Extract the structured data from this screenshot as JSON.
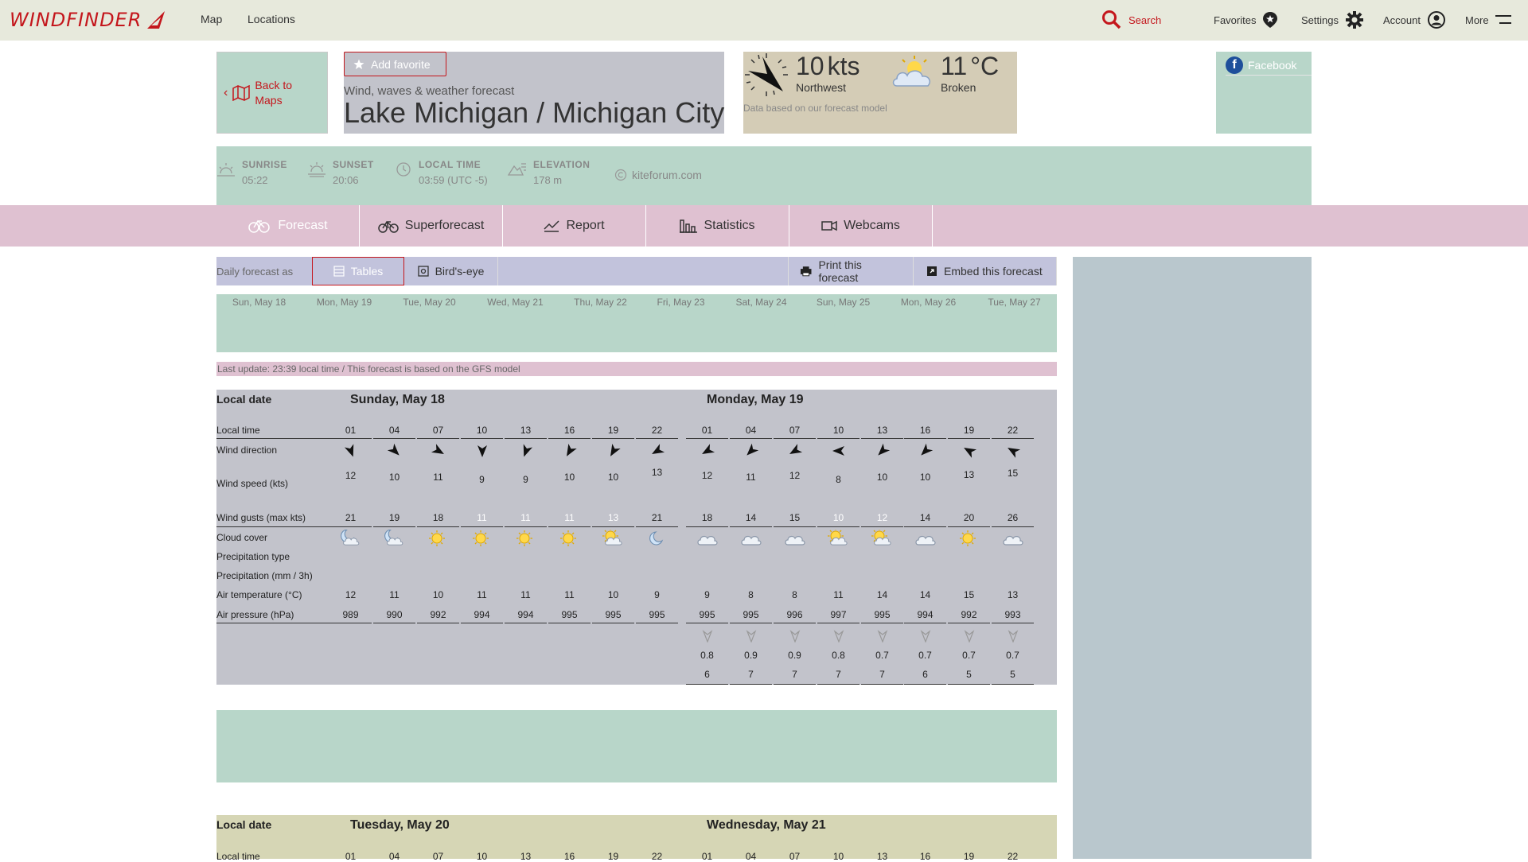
{
  "nav": {
    "logo": "WINDFINDER",
    "links": [
      "Map",
      "Locations"
    ],
    "search": "Search",
    "favorites": "Favorites",
    "settings": "Settings",
    "account": "Account",
    "more": "More"
  },
  "header": {
    "back": "Back to Maps",
    "add_favorite": "Add favorite",
    "subtitle": "Wind, waves & weather forecast",
    "title": "Lake Michigan / Michigan City",
    "current": {
      "speed": "10",
      "unit": "kts",
      "direction": "Northwest",
      "temp": "11",
      "temp_unit": "°C",
      "cloud": "Broken",
      "note": "Data based on our forecast model"
    },
    "facebook": "Facebook"
  },
  "info": {
    "sunrise_label": "SUNRISE",
    "sunrise": "05:22",
    "sunset_label": "SUNSET",
    "sunset": "20:06",
    "localtime_label": "LOCAL TIME",
    "localtime": "03:59 (UTC -5)",
    "elevation_label": "ELEVATION",
    "elevation": "178 m",
    "link": "kiteforum.com"
  },
  "tabs": [
    "Forecast",
    "Superforecast",
    "Report",
    "Statistics",
    "Webcams"
  ],
  "controls": {
    "label": "Daily forecast as",
    "tables": "Tables",
    "birdseye": "Bird's-eye",
    "print": "Print this forecast",
    "embed": "Embed this forecast"
  },
  "days": [
    "Sun, May 18",
    "Mon, May 19",
    "Tue, May 20",
    "Wed, May 21",
    "Thu, May 22",
    "Fri, May 23",
    "Sat, May 24",
    "Sun, May 25",
    "Mon, May 26",
    "Tue, May 27"
  ],
  "update": "Last update: 23:39 local time / This forecast is based on the GFS model",
  "table1": {
    "local_date": "Local date",
    "day1": "Sunday, May 18",
    "day2": "Monday, May 19",
    "labels": {
      "local_time": "Local time",
      "wind_direction": "Wind direction",
      "wind_speed": "Wind speed (kts)",
      "wind_gusts": "Wind gusts (max kts)",
      "cloud_cover": "Cloud cover",
      "precip_type": "Precipitation type",
      "precip": "Precipitation (mm / 3h)",
      "air_temp": "Air temperature (°C)",
      "air_pressure": "Air pressure (hPa)"
    },
    "times": [
      "01",
      "04",
      "07",
      "10",
      "13",
      "16",
      "19",
      "22",
      "01",
      "04",
      "07",
      "10",
      "13",
      "16",
      "19",
      "22"
    ],
    "wind_dir": [
      160,
      135,
      120,
      180,
      200,
      210,
      210,
      240,
      240,
      225,
      240,
      270,
      225,
      225,
      300,
      300
    ],
    "wind_speed": [
      "12",
      "10",
      "11",
      "9",
      "9",
      "10",
      "10",
      "13",
      "12",
      "11",
      "12",
      "8",
      "10",
      "10",
      "13",
      "15"
    ],
    "gusts": [
      "21",
      "19",
      "18",
      "11",
      "11",
      "11",
      "13",
      "21",
      "18",
      "14",
      "15",
      "10",
      "12",
      "14",
      "20",
      "26"
    ],
    "clouds": [
      "night-cloud",
      "night-cloud",
      "sun",
      "sun",
      "sun",
      "sun",
      "sun-cloud",
      "moon",
      "cloud",
      "cloud",
      "cloud",
      "sun-cloud",
      "sun-cloud",
      "cloud",
      "sun",
      "cloud"
    ],
    "air_temp": [
      "12",
      "11",
      "10",
      "11",
      "11",
      "11",
      "10",
      "9",
      "9",
      "8",
      "8",
      "11",
      "14",
      "14",
      "15",
      "13"
    ],
    "pressure": [
      "989",
      "990",
      "992",
      "994",
      "994",
      "995",
      "995",
      "995",
      "995",
      "995",
      "996",
      "997",
      "995",
      "994",
      "992",
      "993"
    ],
    "wave_height": [
      "0.8",
      "0.9",
      "0.9",
      "0.8",
      "0.7",
      "0.7",
      "0.7",
      "0.7"
    ],
    "wave_period": [
      "6",
      "7",
      "7",
      "7",
      "7",
      "6",
      "5",
      "5"
    ]
  },
  "table2": {
    "local_date": "Local date",
    "day1": "Tuesday, May 20",
    "day2": "Wednesday, May 21",
    "local_time": "Local time",
    "times": [
      "01",
      "04",
      "07",
      "10",
      "13",
      "16",
      "19",
      "22",
      "01",
      "04",
      "07",
      "10",
      "13",
      "16",
      "19",
      "22"
    ]
  }
}
